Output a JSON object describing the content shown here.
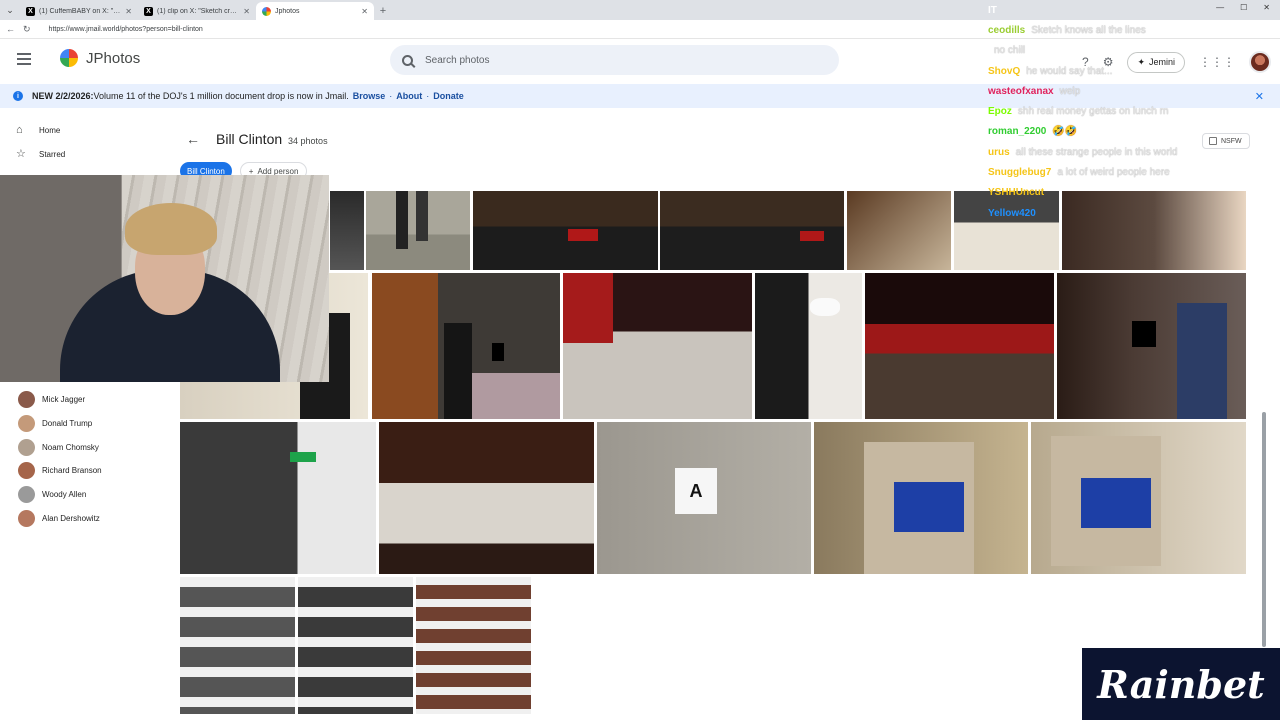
{
  "browser": {
    "tabs": [
      {
        "label": "(1) CuffemBABY on X: \"Cuffem fac",
        "icon": "x",
        "active": false
      },
      {
        "label": "(1) clip on X: \"Sketch crashes o",
        "icon": "x",
        "active": false
      },
      {
        "label": "Jphotos",
        "icon": "j",
        "active": true
      }
    ],
    "url": "https://www.jmail.world/photos?person=bill-clinton"
  },
  "app": {
    "name": "JPhotos",
    "search_placeholder": "Search photos",
    "gemini_label": "Jemini"
  },
  "banner": {
    "prefix": "NEW 2/2/2026:",
    "text": " Volume 11 of the DOJ's 1 million document drop is now in Jmail.",
    "links": [
      "Browse",
      "About",
      "Donate"
    ]
  },
  "sidebar": {
    "items": [
      {
        "label": "Home",
        "icon": "home-icon"
      },
      {
        "label": "Starred",
        "icon": "star-icon"
      }
    ],
    "people": [
      {
        "name": "Mick Jagger",
        "color": "#8a5a4a"
      },
      {
        "name": "Donald Trump",
        "color": "#c49a7a"
      },
      {
        "name": "Noam Chomsky",
        "color": "#b0a090"
      },
      {
        "name": "Richard Branson",
        "color": "#a5654a"
      },
      {
        "name": "Woody Allen",
        "color": "#9a9a9a"
      },
      {
        "name": "Alan Dershowitz",
        "color": "#b5785f"
      }
    ]
  },
  "album": {
    "title": "Bill Clinton",
    "count": "34 photos",
    "chip_selected": "Bill Clinton",
    "chip_add": "Add person",
    "nsfw_label": "NSFW"
  },
  "chat": {
    "lines": [
      {
        "user": "IT",
        "color": "#ffffff",
        "msg": ""
      },
      {
        "user": "ceodills",
        "color": "#9acd32",
        "msg": "Sketch knows all the lines"
      },
      {
        "user": "",
        "color": "#ffffff",
        "msg": "no chill"
      },
      {
        "user": "ShovQ",
        "color": "#f5c518",
        "msg": "he would say that..."
      },
      {
        "user": "wasteofxanax",
        "color": "#e0245e",
        "msg": "welp"
      },
      {
        "user": "Epoz",
        "color": "#7cfc00",
        "msg": "shh real money gettas on lunch rn"
      },
      {
        "user": "roman_2200",
        "color": "#32cd32",
        "msg": "🤣🤣"
      },
      {
        "user": "urus",
        "color": "#f5c518",
        "msg": "all these strange people in this world"
      },
      {
        "user": "Snugglebug7",
        "color": "#f5c518",
        "msg": "a lot of weird people here"
      },
      {
        "user": "YSHHUncut",
        "color": "#f5c518",
        "msg": ""
      },
      {
        "user": "Yellow420",
        "color": "#1e90ff",
        "msg": ""
      }
    ]
  },
  "sponsor": "Rainbet"
}
